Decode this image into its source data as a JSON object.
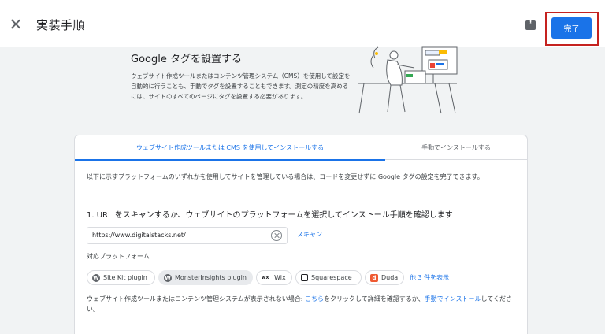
{
  "header": {
    "title": "実装手順",
    "done_label": "完了",
    "close_icon": "close-icon",
    "feedback_icon": "feedback-icon"
  },
  "hero": {
    "title": "Google タグを設置する",
    "description": "ウェブサイト作成ツールまたはコンテンツ管理システム（CMS）を使用して設定を自動的に行うことも、手動でタグを設置することもできます。測定の精度を高めるには、サイトのすべてのページにタグを設置する必要があります。"
  },
  "tabs": [
    {
      "label": "ウェブサイト作成ツールまたは CMS を使用してインストールする",
      "selected": true
    },
    {
      "label": "手動でインストールする",
      "selected": false
    }
  ],
  "intro": "以下に示すプラットフォームのいずれかを使用してサイトを管理している場合は、コードを変更せずに Google タグの設定を完了できます。",
  "step1": "1. URL をスキャンするか、ウェブサイトのプラットフォームを選択してインストール手順を確認します",
  "url_input": {
    "value": "https://www.digitalstacks.net/"
  },
  "scan_label": "スキャン",
  "platforms_label": "対応プラットフォーム",
  "platforms": [
    {
      "label": "Site Kit plugin",
      "icon": "wordpress-icon",
      "selected": false
    },
    {
      "label": "MonsterInsights plugin",
      "icon": "wordpress-icon",
      "selected": true
    },
    {
      "label": "Wix",
      "icon": "wix-icon",
      "selected": false
    },
    {
      "label": "Squarespace",
      "icon": "squarespace-icon",
      "selected": false
    },
    {
      "label": "Duda",
      "icon": "duda-icon",
      "selected": false
    }
  ],
  "more_label": "他 3 件を表示",
  "footer": {
    "prefix": "ウェブサイト作成ツールまたはコンテンツ管理システムが表示されない場合: ",
    "link1": "こちら",
    "middle": "をクリックして詳細を確認するか、",
    "link2": "手動でインストール",
    "suffix": "してください。"
  },
  "colors": {
    "accent": "#1a73e8",
    "highlight_border": "#c5221f",
    "background": "#f1f3f4"
  }
}
